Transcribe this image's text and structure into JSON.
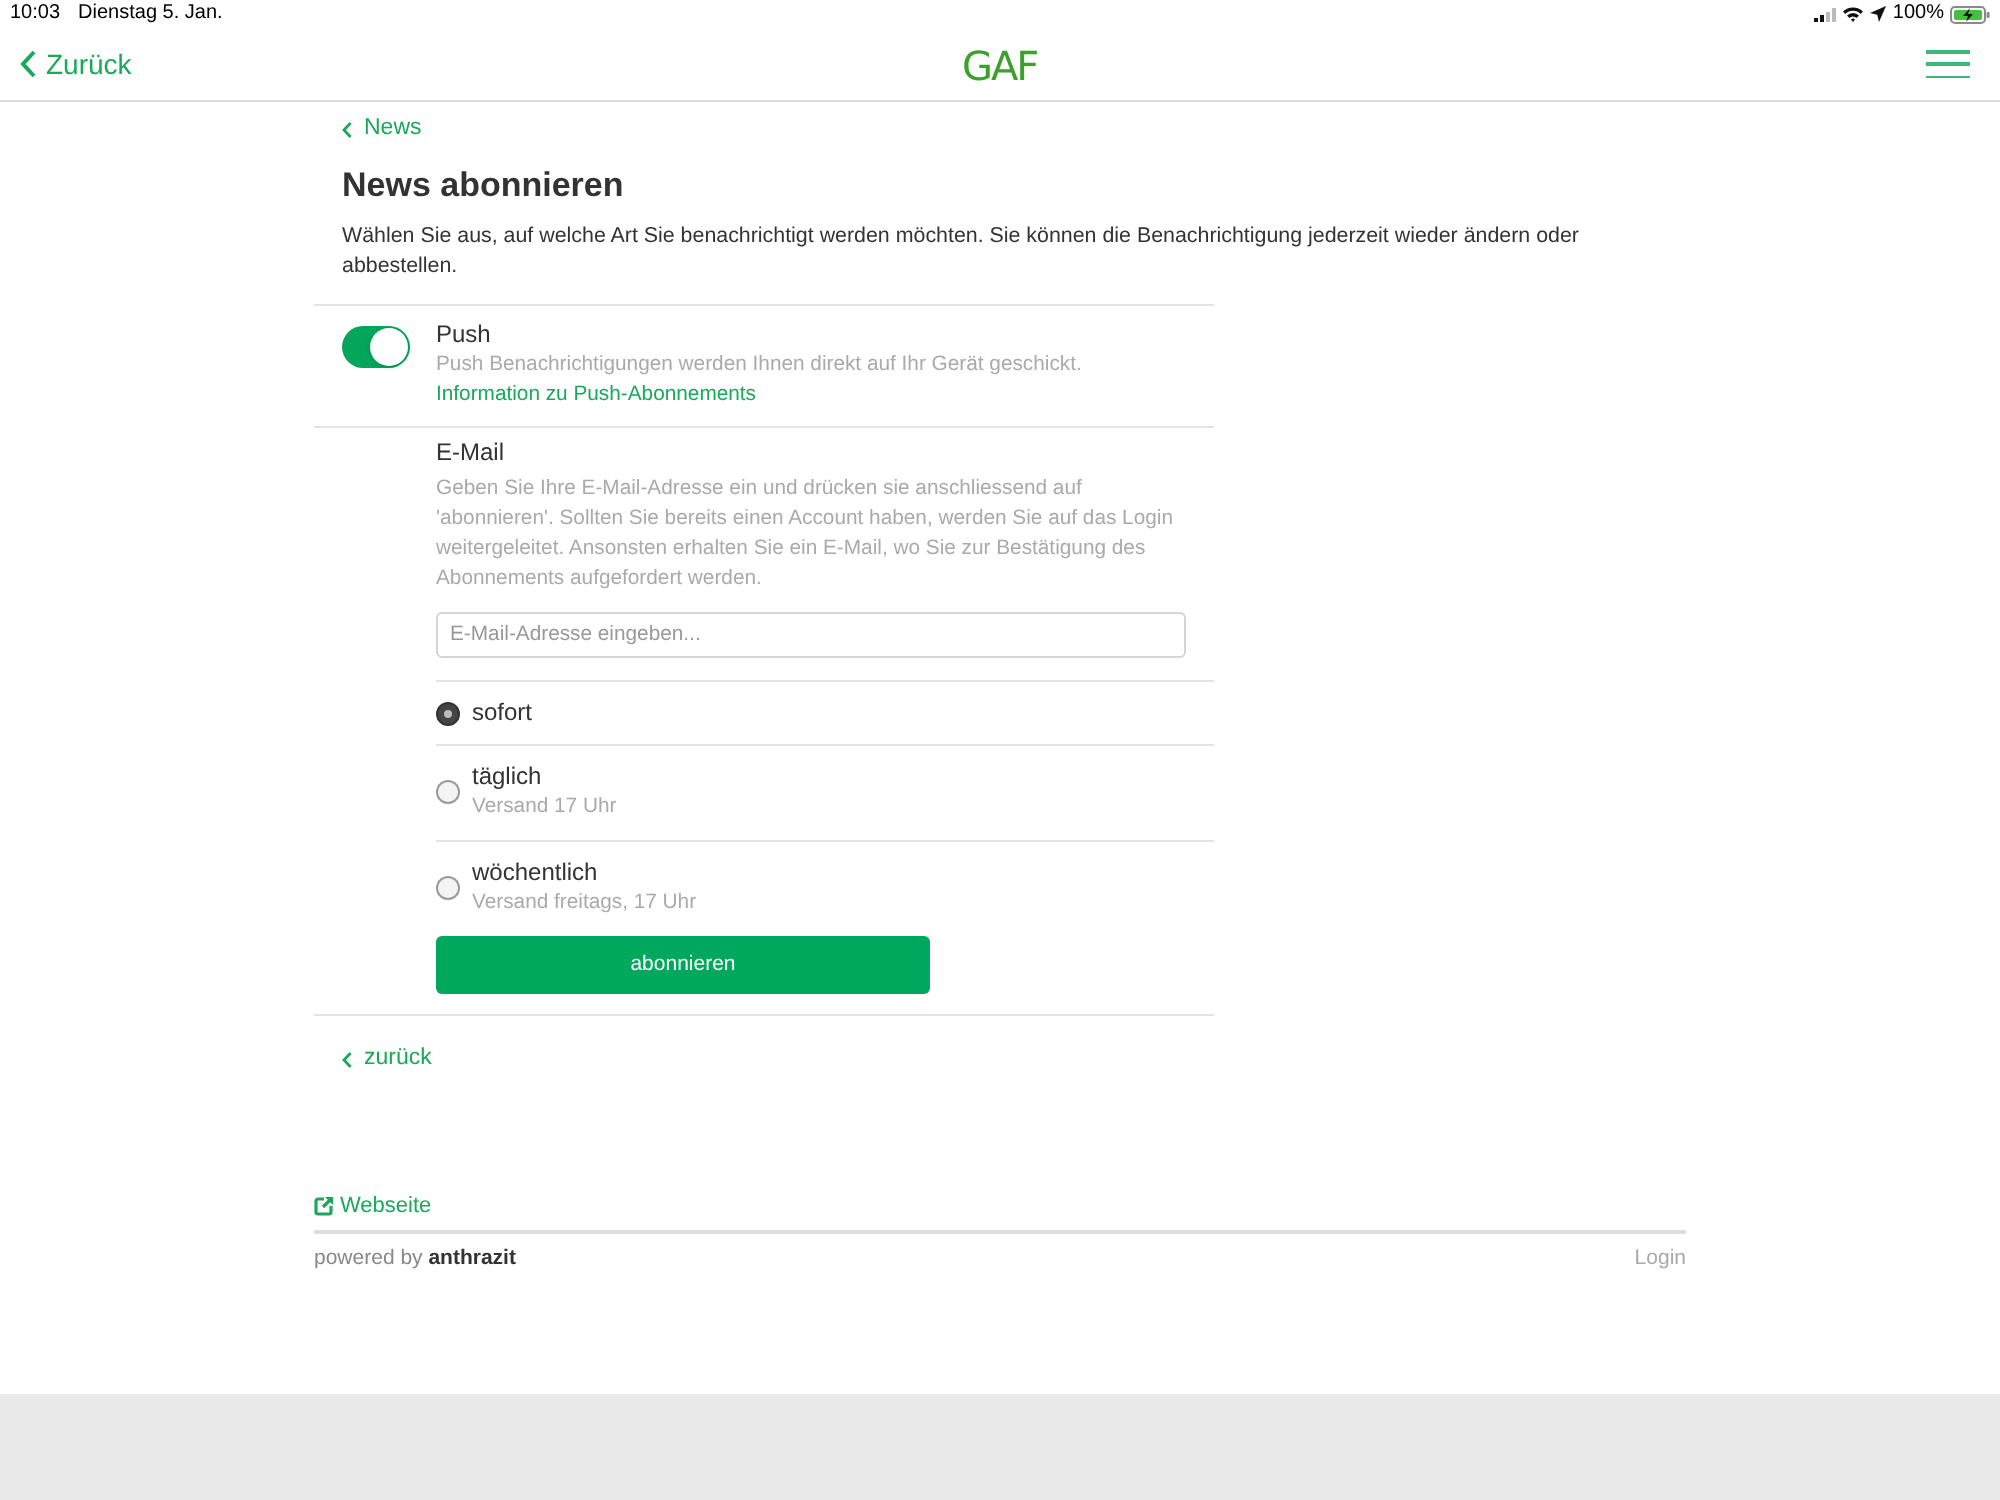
{
  "status_bar": {
    "time": "10:03",
    "date": "Dienstag 5. Jan.",
    "battery": "100%"
  },
  "nav": {
    "back": "Zurück",
    "logo": "GAF"
  },
  "breadcrumb": "News",
  "title": "News abonnieren",
  "intro": "Wählen Sie aus, auf welche Art Sie benachrichtigt werden möchten. Sie können die Benachrichtigung jederzeit wieder ändern oder abbestellen.",
  "push": {
    "label": "Push",
    "on": true,
    "description": "Push Benachrichtigungen werden Ihnen direkt auf Ihr Gerät geschickt.",
    "link": "Information zu Push-Abonnements"
  },
  "email": {
    "label": "E-Mail",
    "description": "Geben Sie Ihre E-Mail-Adresse ein und drücken sie anschliessend auf 'abonnieren'. Sollten Sie bereits einen Account haben, werden Sie auf das Login weitergeleitet. Ansonsten erhalten Sie ein E-Mail, wo Sie zur Bestätigung des Abonnements aufgefordert werden.",
    "placeholder": "E-Mail-Adresse eingeben...",
    "options": [
      {
        "label": "sofort",
        "selected": true
      },
      {
        "label": "täglich",
        "note": "Versand 17 Uhr",
        "selected": false
      },
      {
        "label": "wöchentlich",
        "note": "Versand freitags, 17 Uhr",
        "selected": false
      }
    ],
    "button": "abonnieren"
  },
  "back_link": "zurück",
  "footer": {
    "website": "Webseite",
    "powered_by": "powered by **anthrazit**",
    "login": "Login"
  }
}
